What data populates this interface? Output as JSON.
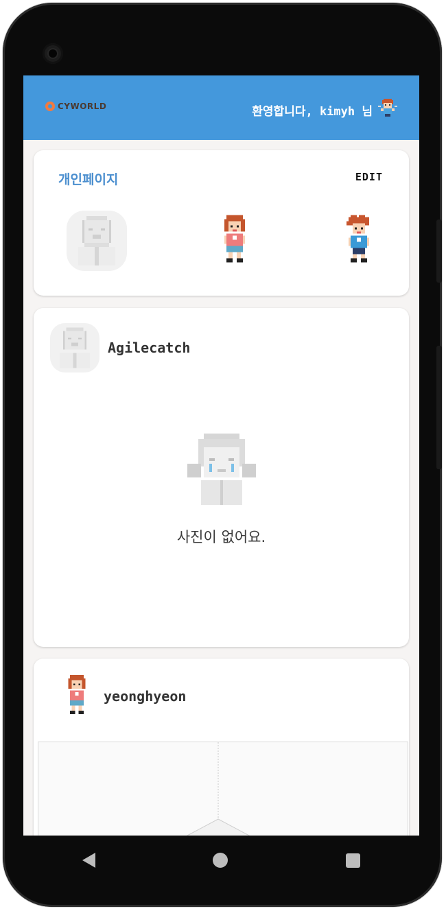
{
  "header": {
    "logo_text": "CYWORLD",
    "welcome_text": "환영합니다, kimyh 님"
  },
  "personal_card": {
    "title": "개인페이지",
    "edit_label": "EDIT"
  },
  "post1": {
    "username": "Agilecatch",
    "empty_message": "사진이 없어요."
  },
  "post2": {
    "username": "yeonghyeon"
  },
  "colors": {
    "brand_blue": "#4498dc",
    "logo_orange": "#f27a3f",
    "title_blue": "#4c8fcf"
  },
  "icons": {
    "back": "triangle-left",
    "home": "circle",
    "recent": "square"
  }
}
